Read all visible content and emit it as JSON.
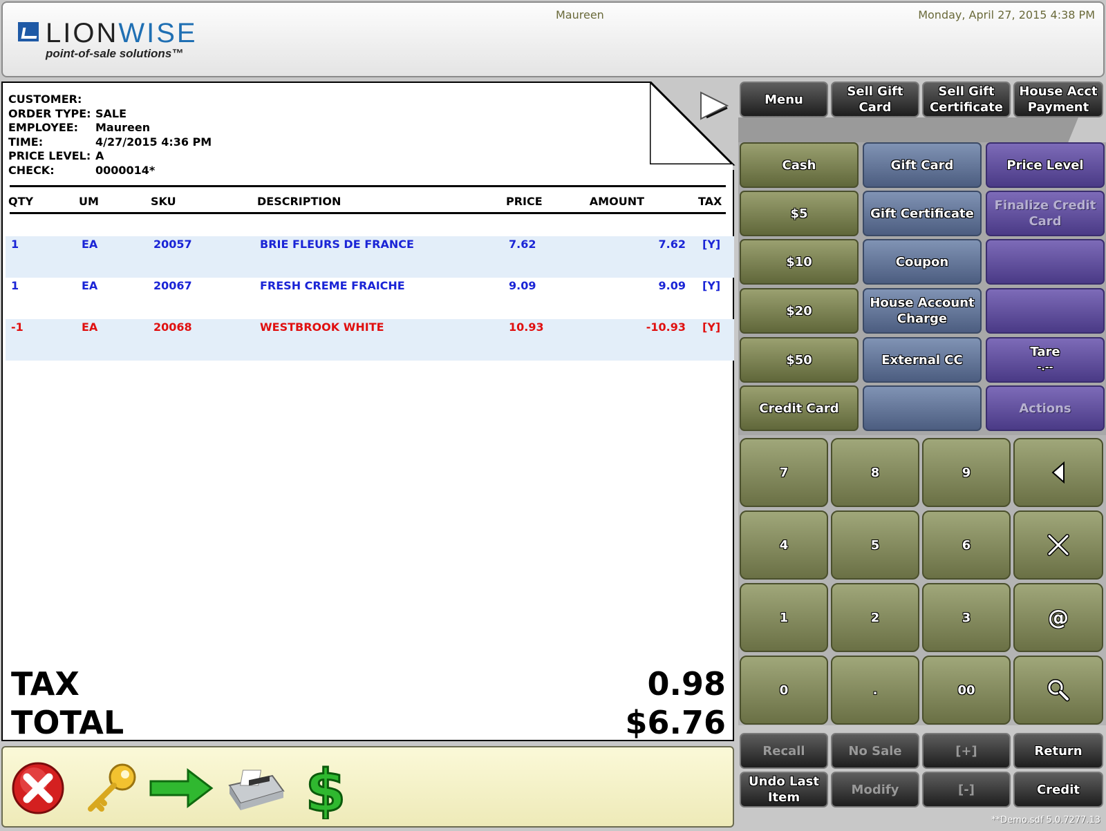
{
  "header": {
    "logo_word1": "LION",
    "logo_word2": "WISE",
    "logo_tagline": "point-of-sale solutions™",
    "user": "Maureen",
    "datetime": "Monday, April 27, 2015 4:38 PM"
  },
  "order": {
    "labels": {
      "customer": "CUSTOMER:",
      "order_type": "ORDER TYPE:",
      "employee": "EMPLOYEE:",
      "time": "TIME:",
      "price_level": "PRICE LEVEL:",
      "check": "CHECK:"
    },
    "customer": "",
    "order_type": "SALE",
    "employee": "Maureen",
    "time": "4/27/2015 4:36 PM",
    "price_level": "A",
    "check": "0000014*"
  },
  "columns": {
    "qty": "QTY",
    "um": "UM",
    "sku": "SKU",
    "description": "DESCRIPTION",
    "price": "PRICE",
    "amount": "AMOUNT",
    "tax": "TAX"
  },
  "lines": [
    {
      "qty": "1",
      "um": "EA",
      "sku": "20057",
      "description": "BRIE FLEURS DE FRANCE",
      "price": "7.62",
      "amount": "7.62",
      "tax": "[Y]"
    },
    {
      "qty": "1",
      "um": "EA",
      "sku": "20067",
      "description": "FRESH CREME FRAICHE",
      "price": "9.09",
      "amount": "9.09",
      "tax": "[Y]"
    },
    {
      "qty": "-1",
      "um": "EA",
      "sku": "20068",
      "description": "WESTBROOK WHITE",
      "price": "10.93",
      "amount": "-10.93",
      "tax": "[Y]"
    }
  ],
  "totals": {
    "tax_label": "TAX",
    "tax_value": "0.98",
    "total_label": "TOTAL",
    "total_value": "$6.76"
  },
  "top_buttons": {
    "menu": "Menu",
    "sell_gift_card": "Sell Gift Card",
    "sell_gift_certificate": "Sell Gift Certificate",
    "house_acct_payment": "House Acct Payment"
  },
  "payments": {
    "cash": "Cash",
    "five": "$5",
    "ten": "$10",
    "twenty": "$20",
    "fifty": "$50",
    "credit_card": "Credit Card",
    "gift_card": "Gift Card",
    "gift_certificate": "Gift Certificate",
    "coupon": "Coupon",
    "house_account_charge": "House Account Charge",
    "external_cc": "External CC",
    "price_level": "Price Level",
    "finalize_credit_card": "Finalize Credit Card",
    "tare": "Tare",
    "tare_value": "-.--",
    "actions": "Actions"
  },
  "keypad": {
    "k7": "7",
    "k8": "8",
    "k9": "9",
    "k4": "4",
    "k5": "5",
    "k6": "6",
    "k1": "1",
    "k2": "2",
    "k3": "3",
    "k0": "0",
    "kdot": ".",
    "k00": "00",
    "kat": "@"
  },
  "bottom_buttons": {
    "recall": "Recall",
    "no_sale": "No Sale",
    "plus": "[+]",
    "return": "Return",
    "undo_last_item": "Undo Last Item",
    "modify": "Modify",
    "minus": "[-]",
    "credit": "Credit"
  },
  "footer": {
    "version": "**Demo.sdf 5.0.7277.13"
  },
  "colors": {
    "item_blue": "#1a24d6",
    "item_red": "#e01010",
    "row_alt": "#e3eef9",
    "olive": "#7f8556",
    "slate": "#63749a",
    "violet": "#5c4b9e"
  }
}
